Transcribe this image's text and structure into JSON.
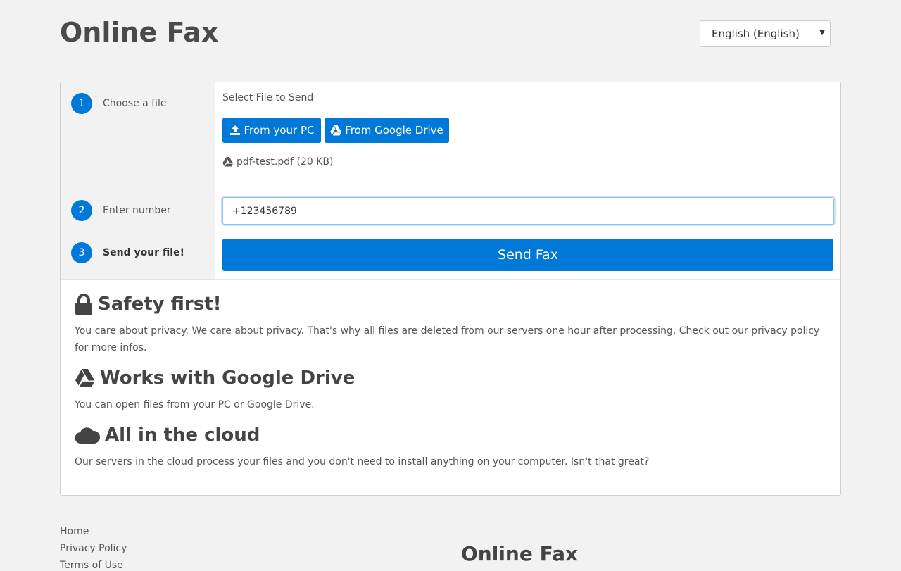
{
  "header": {
    "title": "Online Fax",
    "language_select": "English (English)"
  },
  "steps": [
    {
      "number": "1",
      "label": "Choose a file"
    },
    {
      "number": "2",
      "label": "Enter number"
    },
    {
      "number": "3",
      "label": "Send your file!"
    }
  ],
  "upload": {
    "label": "Select File to Send",
    "from_pc_label": "From your PC",
    "from_drive_label": "From Google Drive",
    "selected_file": "pdf-test.pdf (20 KB)"
  },
  "number_input": {
    "value": "+123456789"
  },
  "send_button_label": "Send Fax",
  "features": [
    {
      "icon": "lock-icon",
      "title": "Safety first!",
      "text": "You care about privacy. We care about privacy. That's why all files are deleted from our servers one hour after processing. Check out our privacy policy for more infos."
    },
    {
      "icon": "google-drive-icon",
      "title": "Works with Google Drive",
      "text": "You can open files from your PC or Google Drive."
    },
    {
      "icon": "cloud-icon",
      "title": "All in the cloud",
      "text": "Our servers in the cloud process your files and you don't need to install anything on your computer. Isn't that great?"
    }
  ],
  "footer": {
    "links": [
      "Home",
      "Privacy Policy",
      "Terms of Use"
    ],
    "title": "Online Fax"
  },
  "colors": {
    "accent": "#0078d7",
    "background": "#f2f2f2",
    "text": "#444444"
  }
}
